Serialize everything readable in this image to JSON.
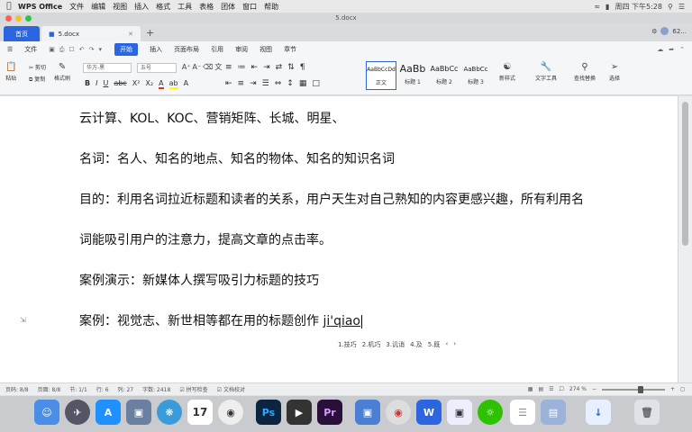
{
  "menubar": {
    "app_name": "WPS Office",
    "items": [
      "文件",
      "编辑",
      "视图",
      "插入",
      "格式",
      "工具",
      "表格",
      "团体",
      "窗口",
      "帮助"
    ],
    "clock": "周四 下午5:28"
  },
  "window": {
    "title": "5.docx"
  },
  "tabs": {
    "home": "首页",
    "doc": "5.docx",
    "user": "62..."
  },
  "ribbon_menu": {
    "file": "文件",
    "items": [
      "开始",
      "插入",
      "页面布局",
      "引用",
      "审阅",
      "视图",
      "章节"
    ],
    "active": "开始"
  },
  "toolbar": {
    "paste": "粘贴",
    "cut": "剪切",
    "copy": "复制",
    "format_painter": "格式刷",
    "font_name": "华方-黑",
    "font_size": "五号",
    "styles": [
      {
        "sample": "AaBbCcDd",
        "label": "正文"
      },
      {
        "sample": "AaBb",
        "label": "标题 1"
      },
      {
        "sample": "AaBbCc",
        "label": "标题 2"
      },
      {
        "sample": "AaBbCc",
        "label": "标题 3"
      }
    ],
    "new_style": "新样式",
    "text_tools": "文字工具",
    "find_replace": "查找替换",
    "select": "选择"
  },
  "document": {
    "paragraphs": [
      "云计算、KOL、KOC、营销矩阵、长城、明星、",
      "名词：名人、知名的地点、知名的物体、知名的知识名词",
      "目的：利用名词拉近标题和读者的关系，用户天生对自己熟知的内容更感兴趣，所有利用名",
      "词能吸引用户的注意力，提高文章的点击率。",
      "案例演示：新媒体人撰写吸引力标题的技巧"
    ],
    "last_para_prefix": "案例：视觉志、新世相等都在用的标题创作",
    "ime_composition": "ji'qiao",
    "ime_candidates": [
      "1.技巧",
      "2.机巧",
      "3.讥诮",
      "4.及",
      "5.既"
    ]
  },
  "status": {
    "page": "页码: 8/8",
    "section": "页面: 8/8",
    "sect": "节: 1/1",
    "line": "行: 6",
    "col": "列: 27",
    "words": "字数: 2418",
    "spell": "拼写检查",
    "doc_check": "文档校对",
    "zoom": "274 %"
  },
  "dock": [
    "Finder",
    "Launchpad",
    "App Store",
    "Preview",
    "Safari",
    "Calendar",
    "Chrome",
    "Photoshop",
    "Screenflow",
    "Premiere",
    "Keynote",
    "Chrome",
    "WPS",
    "Preview2",
    "WeChat",
    "Notes",
    "Downloads",
    "Trash"
  ]
}
